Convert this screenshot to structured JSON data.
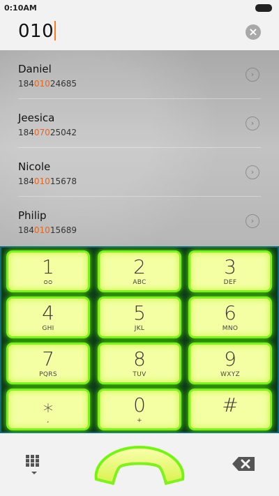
{
  "status": {
    "time": "0:10AM"
  },
  "dialer": {
    "query": "010",
    "clear_icon": "close-circle-icon"
  },
  "contacts": [
    {
      "name": "Daniel",
      "number_pre": "184",
      "number_match": "010",
      "number_post": "24685"
    },
    {
      "name": "Jeesica",
      "number_pre": "184",
      "number_match": "070",
      "number_post": "25042"
    },
    {
      "name": "Nicole",
      "number_pre": "184",
      "number_match": "010",
      "number_post": "15678"
    },
    {
      "name": "Philip",
      "number_pre": "184",
      "number_match": "010",
      "number_post": "15689"
    }
  ],
  "keypad": {
    "keys": [
      {
        "digit": "1",
        "letters": "ᴑᴑ"
      },
      {
        "digit": "2",
        "letters": "ABC"
      },
      {
        "digit": "3",
        "letters": "DEF"
      },
      {
        "digit": "4",
        "letters": "GHI"
      },
      {
        "digit": "5",
        "letters": "JKL"
      },
      {
        "digit": "6",
        "letters": "MNO"
      },
      {
        "digit": "7",
        "letters": "PQRS"
      },
      {
        "digit": "8",
        "letters": "TUV"
      },
      {
        "digit": "9",
        "letters": "WXYZ"
      },
      {
        "digit": "⁎",
        "letters": ","
      },
      {
        "digit": "0",
        "letters": "+"
      },
      {
        "digit": "#",
        "letters": ""
      }
    ]
  },
  "colors": {
    "highlight": "#e8651e",
    "key_face": "#f4ffa4",
    "key_glow": "#7ef21a",
    "keypad_bg": "#0d3c18"
  },
  "bottom": {
    "dialpad_icon": "dialpad-grid-icon",
    "call_icon": "phone-handset-icon",
    "backspace_icon": "backspace-icon"
  }
}
